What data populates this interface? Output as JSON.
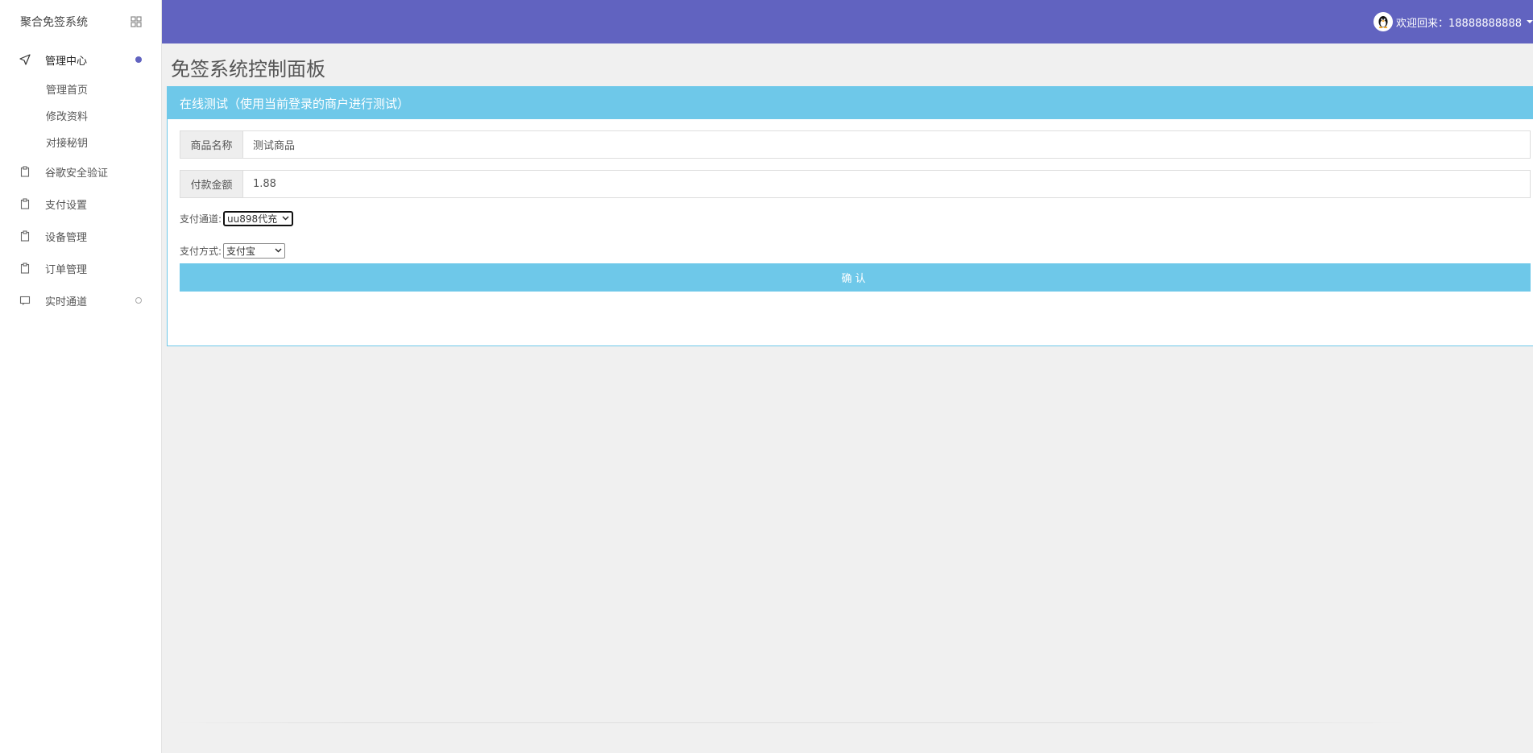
{
  "app": {
    "brand": "聚合免签系统"
  },
  "header": {
    "welcome": "欢迎回来：18888888888"
  },
  "sidebar": {
    "groups": [
      {
        "label": "管理中心",
        "icon": "send-icon",
        "children": [
          "管理首页",
          "修改资料",
          "对接秘钥"
        ]
      },
      {
        "label": "谷歌安全验证",
        "icon": "clipboard-icon"
      },
      {
        "label": "支付设置",
        "icon": "clipboard-icon"
      },
      {
        "label": "设备管理",
        "icon": "clipboard-icon"
      },
      {
        "label": "订单管理",
        "icon": "clipboard-icon"
      },
      {
        "label": "实时通道",
        "icon": "monitor-icon"
      }
    ]
  },
  "main": {
    "title": "免签系统控制面板",
    "panel": {
      "heading": "在线测试（使用当前登录的商户进行测试）",
      "product_label": "商品名称",
      "product_value": "测试商品",
      "amount_label": "付款金额",
      "amount_value": "1.88",
      "channel_label": "支付通道:",
      "channel_value": "uu898代充",
      "method_label": "支付方式:",
      "method_value": "支付宝",
      "confirm_label": "确认"
    }
  },
  "colors": {
    "header_bg": "#6163c0",
    "panel_accent": "#6ec8e9",
    "page_bg": "#f0f0f0"
  }
}
